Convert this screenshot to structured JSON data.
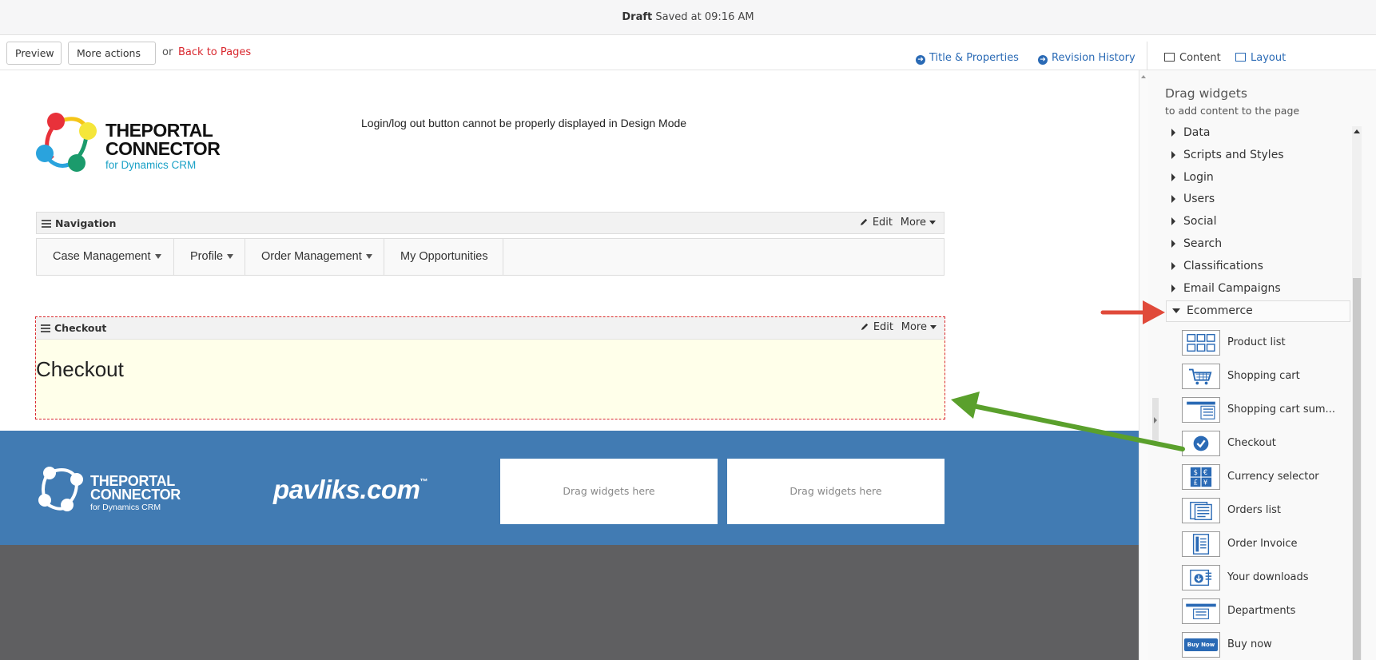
{
  "status": {
    "state": "Draft",
    "saved": "Saved at 09:16 AM"
  },
  "toolbar": {
    "preview": "Preview",
    "more_actions": "More actions",
    "or": "or",
    "back": "Back to Pages",
    "title_props": "Title & Properties",
    "revision_history": "Revision History",
    "content": "Content",
    "layout": "Layout"
  },
  "page": {
    "logo_line1": "THEPORTAL",
    "logo_line2": "CONNECTOR",
    "logo_line3": "for Dynamics CRM",
    "login_note": "Login/log out button cannot be properly displayed in Design Mode",
    "nav_widget": {
      "title": "Navigation",
      "edit": "Edit",
      "more": "More"
    },
    "nav_items": [
      {
        "label": "Case Management",
        "dropdown": true
      },
      {
        "label": "Profile",
        "dropdown": true
      },
      {
        "label": "Order Management",
        "dropdown": true
      },
      {
        "label": "My Opportunities",
        "dropdown": false
      }
    ],
    "checkout_widget": {
      "title": "Checkout",
      "edit": "Edit",
      "more": "More",
      "heading": "Checkout"
    }
  },
  "footer": {
    "logo_line1": "THEPORTAL",
    "logo_line2": "CONNECTOR",
    "logo_line3": "for Dynamics CRM",
    "brand": "pavliks.com",
    "brand_tm": "™",
    "drop1": "Drag widgets here",
    "drop2": "Drag widgets here"
  },
  "panel": {
    "title": "Drag widgets",
    "subtitle": "to add content to the page",
    "categories": [
      "Data",
      "Scripts and Styles",
      "Login",
      "Users",
      "Social",
      "Search",
      "Classifications",
      "Email Campaigns"
    ],
    "open_category": "Ecommerce",
    "widgets": [
      {
        "label": "Product list",
        "icon": "product-list-icon"
      },
      {
        "label": "Shopping cart",
        "icon": "shopping-cart-icon"
      },
      {
        "label": "Shopping cart sum...",
        "icon": "cart-summary-icon"
      },
      {
        "label": "Checkout",
        "icon": "checkout-check-icon"
      },
      {
        "label": "Currency selector",
        "icon": "currency-icon"
      },
      {
        "label": "Orders list",
        "icon": "orders-list-icon"
      },
      {
        "label": "Order Invoice",
        "icon": "invoice-icon"
      },
      {
        "label": "Your downloads",
        "icon": "downloads-icon"
      },
      {
        "label": "Departments",
        "icon": "departments-icon"
      },
      {
        "label": "Buy now",
        "icon": "buy-now-icon",
        "icon_text": "Buy Now"
      }
    ]
  },
  "colors": {
    "link": "#2a6ab5",
    "danger": "#d9272e",
    "footer_blue": "#417bb3",
    "footer_dark": "#5f5f61",
    "highlight": "#ffffea",
    "annot_red": "#e04a3a",
    "annot_green": "#5aa02c"
  }
}
